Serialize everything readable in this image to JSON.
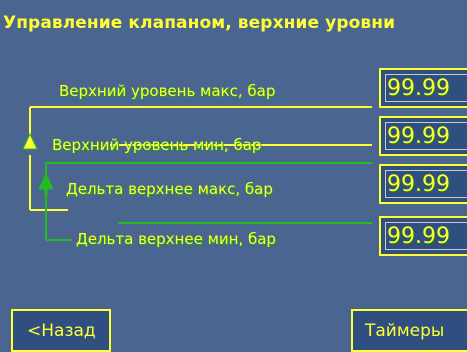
{
  "screen": {
    "title": "Управление клапаном, верхние уровни"
  },
  "parameters": [
    {
      "label": "Верхний уровень макс, бар",
      "value": "99.99"
    },
    {
      "label": "Верхний уровень мин, бар",
      "value": "99.99"
    },
    {
      "label": "Дельта верхнее макс, бар",
      "value": "99.99"
    },
    {
      "label": "Дельта верхнее мин, бар",
      "value": "99.99"
    }
  ],
  "navigation": {
    "back_label": "<Назад",
    "next_label": "Таймеры"
  },
  "colors": {
    "background": "#4a6690",
    "text": "#ffff33",
    "accent_green": "#22bb22",
    "field_bg": "#2f4f80"
  },
  "icons": [
    "up-arrow-icon-yellow",
    "up-arrow-icon-green"
  ]
}
